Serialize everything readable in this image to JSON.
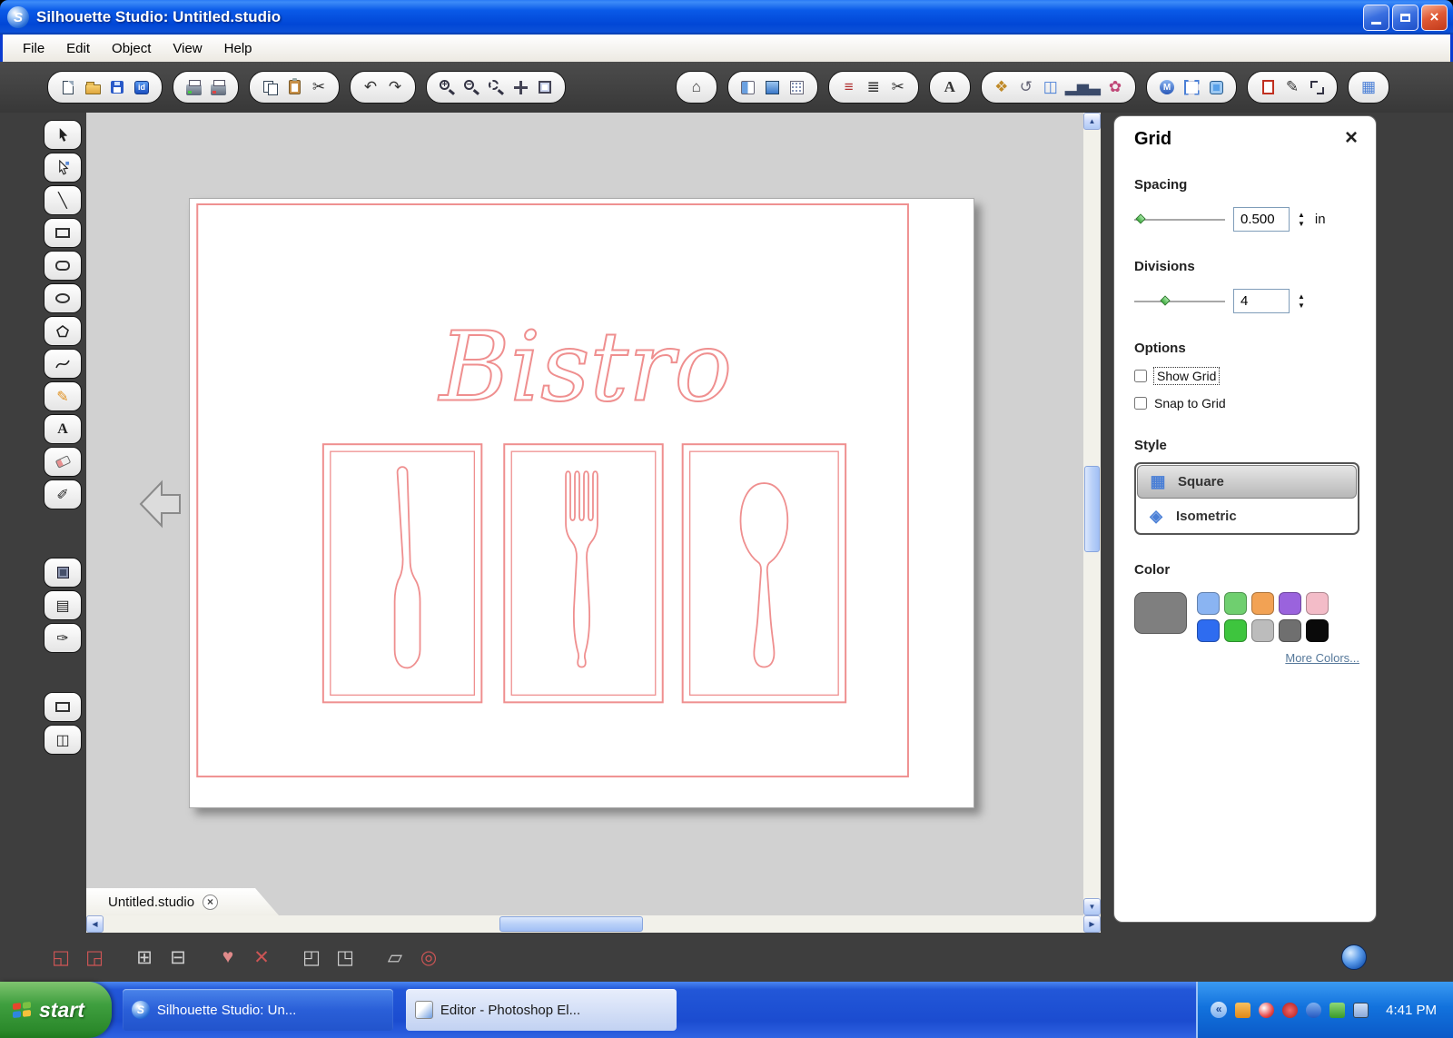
{
  "window": {
    "title": "Silhouette Studio: Untitled.studio",
    "close_glyph": "×",
    "logo_glyph": "S"
  },
  "menu": {
    "file": "File",
    "edit": "Edit",
    "object": "Object",
    "view": "View",
    "help": "Help"
  },
  "icons": {
    "library_label": "id",
    "zoom_in": "+",
    "zoom_out": "−",
    "scissors": "✂",
    "undo": "↶",
    "redo": "↷",
    "home": "⌂",
    "text": "A",
    "line_style": "≡",
    "text_align": "≣",
    "ornament": "❖",
    "revolve": "↺",
    "modify": "◫",
    "stats": "▂▅▃",
    "flower": "✿",
    "pixscan": "M",
    "pen": "✎",
    "grid": "▦",
    "line_tool": "╲",
    "pencil_tool": "✎",
    "text_tool": "A",
    "knife_tool": "✐",
    "sketch_tool": "▤",
    "emboss_tool": "✑",
    "split_tool": "◫",
    "spin_up": "▲",
    "spin_down": "▼",
    "scroll_up": "▲",
    "scroll_down": "▼",
    "scroll_left": "◀",
    "scroll_right": "▶",
    "tray_chevron": "«",
    "group": "◱",
    "ungroup": "◲",
    "compound": "⊞",
    "release": "⊟",
    "weld": "♥",
    "subtract": "✕",
    "forward": "◰",
    "backward": "◳",
    "shadow": "▱",
    "target": "◎",
    "isometric": "◈",
    "square_grid": "▦"
  },
  "canvas": {
    "design_text": "Bistro",
    "cut_line_color": "#ef8f8f",
    "tab_label": "Untitled.studio",
    "tab_close": "×"
  },
  "grid_panel": {
    "title": "Grid",
    "close": "×",
    "spacing_label": "Spacing",
    "spacing_value": "0.500",
    "spacing_unit": "in",
    "divisions_label": "Divisions",
    "divisions_value": "4",
    "options_label": "Options",
    "show_grid": "Show Grid",
    "snap_to_grid": "Snap to Grid",
    "style_label": "Style",
    "style_square": "Square",
    "style_isometric": "Isometric",
    "color_label": "Color",
    "more_colors": "More Colors...",
    "selected_color_style": "background:#7f7f7f",
    "swatches": [
      {
        "style": "background:#8ab4f2"
      },
      {
        "style": "background:#6fcf6f"
      },
      {
        "style": "background:#f2a254"
      },
      {
        "style": "background:#9a63dd"
      },
      {
        "style": "background:#f3bcc8"
      },
      {
        "style": "background:#2e6cf0"
      },
      {
        "style": "background:#3ec53e"
      },
      {
        "style": "background:#bcbcbc"
      },
      {
        "style": "background:#6f6f6f"
      },
      {
        "style": "background:#0a0a0a"
      }
    ]
  },
  "taskbar": {
    "start_label": "start",
    "tasks": [
      {
        "label": "Silhouette Studio: Un..."
      },
      {
        "label": "Editor - Photoshop El..."
      }
    ],
    "time": "4:41 PM"
  }
}
